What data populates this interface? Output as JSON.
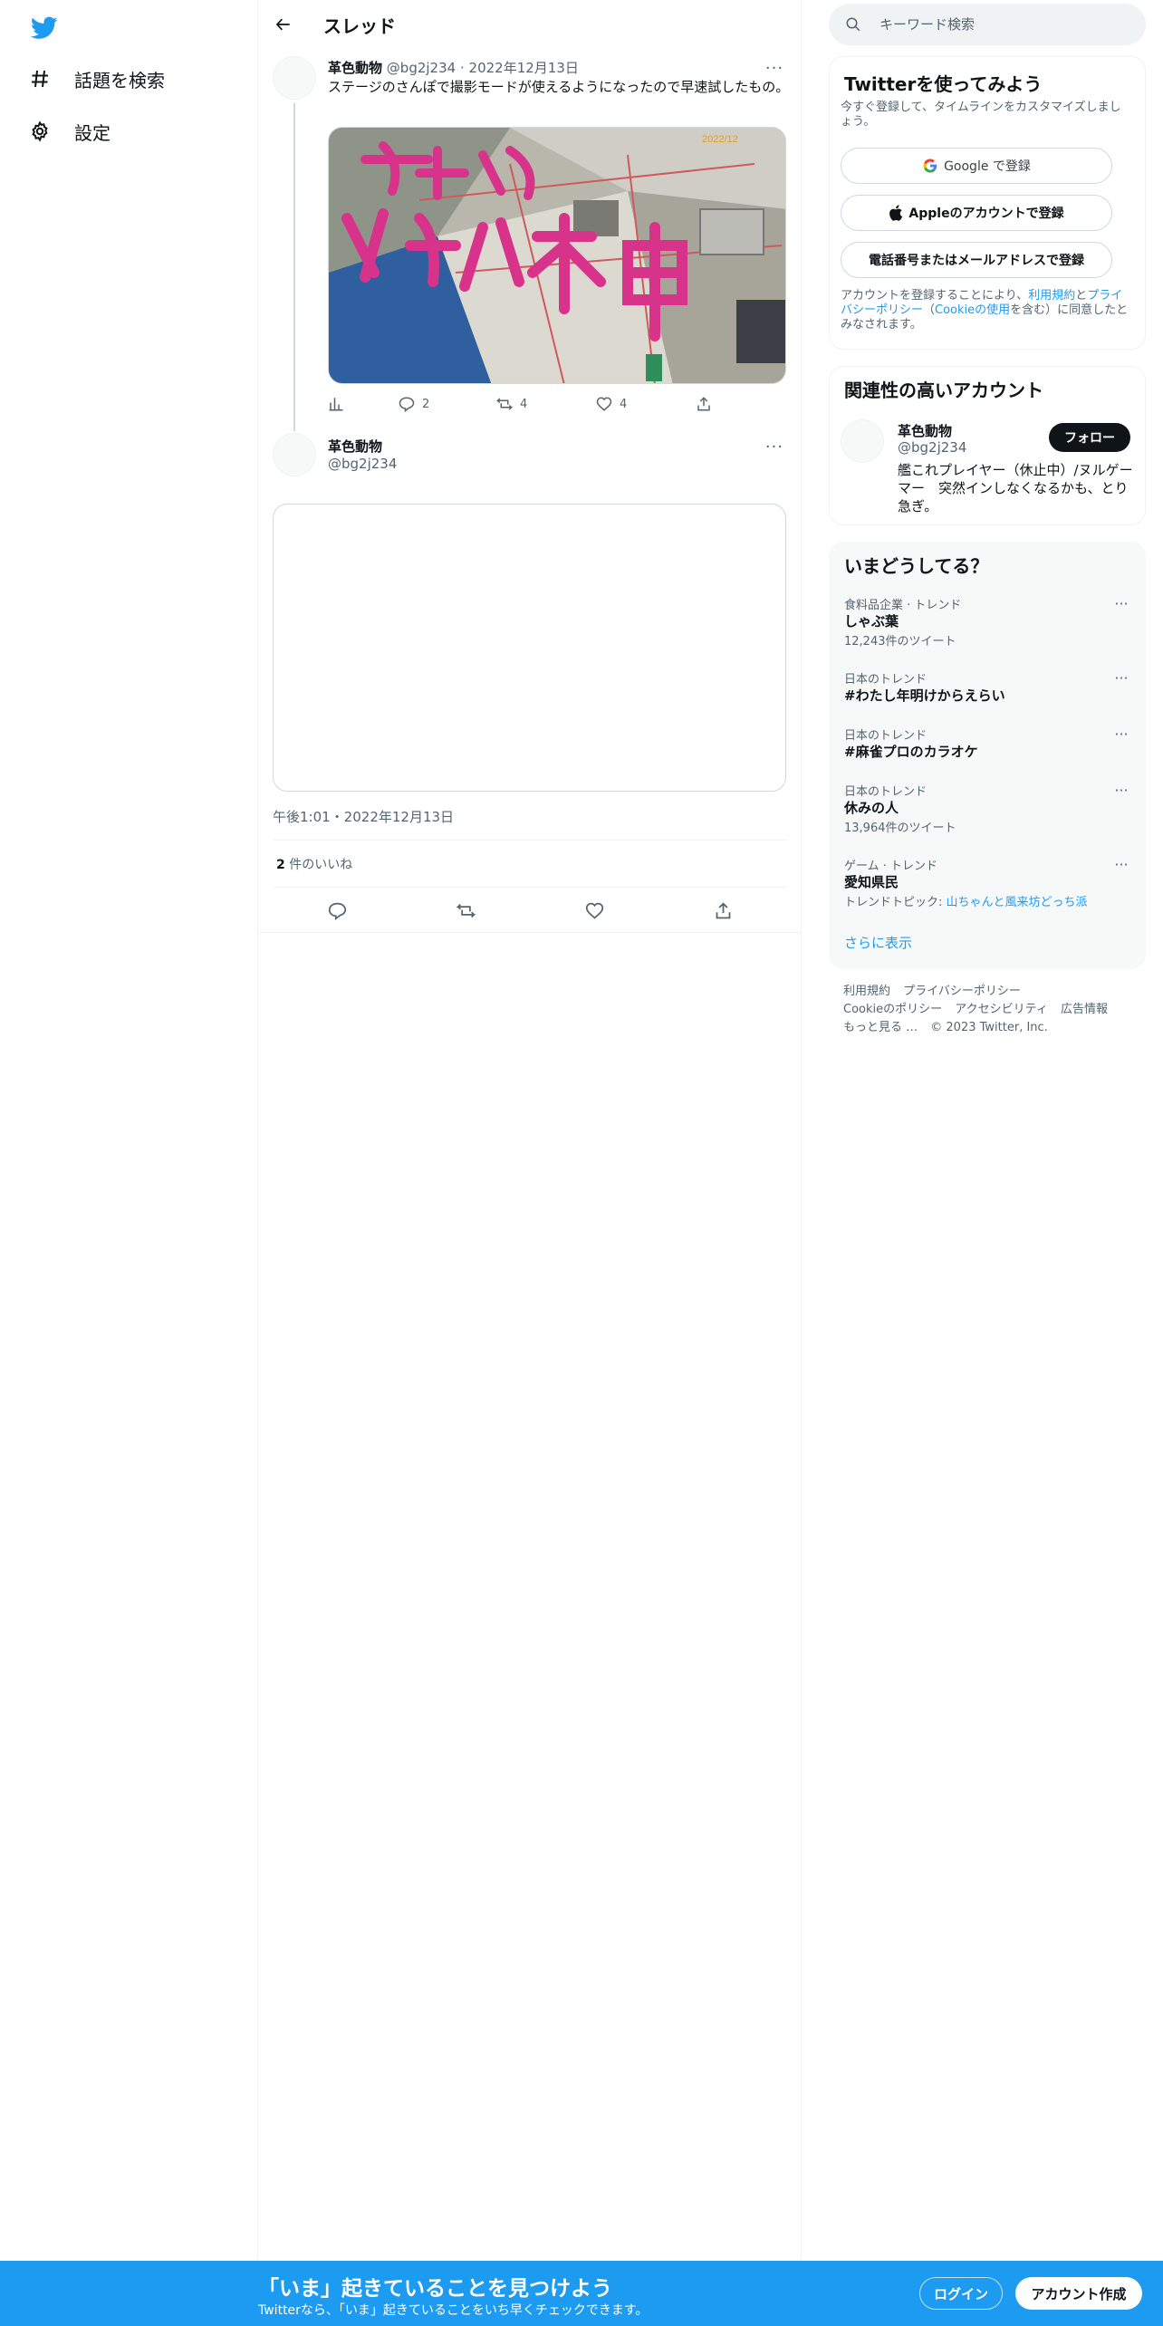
{
  "nav": {
    "items": [
      {
        "label": "話題を検索",
        "icon": "hashtag-icon"
      },
      {
        "label": "設定",
        "icon": "gear-icon"
      }
    ]
  },
  "main": {
    "title": "スレッド",
    "tweet": {
      "name": "革色動物",
      "handle": "@bg2j234",
      "sep": "·",
      "date": "2022年12月13日",
      "more": "···",
      "text": "ステージのさんぽで撮影モードが使えるようになったので早速試したもの。",
      "image_overlay": "2022/12",
      "stats": {
        "replies": "2",
        "retweets": "4",
        "likes": "4"
      }
    },
    "reply_author": {
      "name": "革色動物",
      "handle": "@bg2j234",
      "more": "···"
    },
    "detail": {
      "timestamp": "午後1:01・2022年12月13日",
      "likes_count": "2",
      "likes_label": " 件のいいね"
    }
  },
  "sidebar": {
    "search_placeholder": "キーワード検索",
    "signup": {
      "title": "Twitterを使ってみよう",
      "subtitle": "今すぐ登録して、タイムラインをカスタマイズしましょう。",
      "google": "Google で登録",
      "apple": "Appleのアカウントで登録",
      "phone": "電話番号またはメールアドレスで登録",
      "legal_prefix": "アカウントを登録することにより、",
      "legal_terms": "利用規約",
      "legal_and": "と",
      "legal_privacy": "プライバシーポリシー",
      "legal_open": "（",
      "legal_cookie": "Cookieの使用",
      "legal_suffix": "を含む）に同意したとみなされます。"
    },
    "related": {
      "title": "関連性の高いアカウント",
      "name": "革色動物",
      "handle": "@bg2j234",
      "follow": "フォロー",
      "bio": "艦これプレイヤー（休止中）/ヌルゲーマー　突然インしなくなるかも、とり急ぎ。"
    },
    "trends": {
      "title": "いまどうしてる？",
      "items": [
        {
          "category": "食料品企業 · トレンド",
          "name": "しゃぶ葉",
          "count": "12,243件のツイート"
        },
        {
          "category": "日本のトレンド",
          "name": "#わたし年明けからえらい",
          "count": ""
        },
        {
          "category": "日本のトレンド",
          "name": "#麻雀プロのカラオケ",
          "count": ""
        },
        {
          "category": "日本のトレンド",
          "name": "休みの人",
          "count": "13,964件のツイート"
        },
        {
          "category": "ゲーム · トレンド",
          "name": "愛知県民",
          "topic_label": "トレンドトピック: ",
          "topic": "山ちゃんと風来坊どっち派"
        }
      ],
      "show_more": "さらに表示"
    },
    "footer": {
      "links": [
        "利用規約",
        "プライバシーポリシー",
        "Cookieのポリシー",
        "アクセシビリティ",
        "広告情報",
        "もっと見る …"
      ],
      "copyright": "© 2023 Twitter, Inc."
    }
  },
  "bottom_bar": {
    "title": "「いま」起きていることを見つけよう",
    "subtitle": "Twitterなら、「いま」起きていることをいち早くチェックできます。",
    "login": "ログイン",
    "signup": "アカウント作成"
  },
  "colors": {
    "brand": "#1d9bf0",
    "text": "#0f1419",
    "muted": "#536471"
  }
}
